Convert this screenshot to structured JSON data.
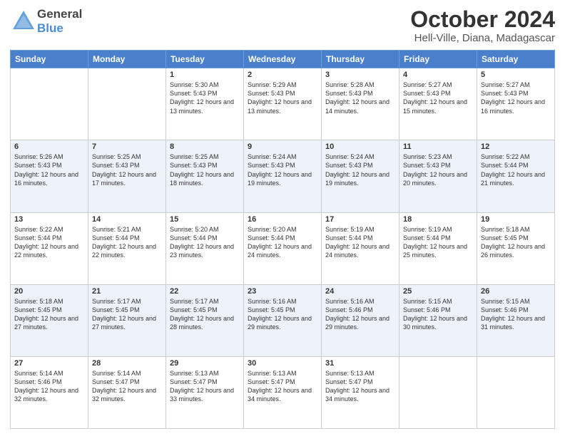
{
  "header": {
    "logo_general": "General",
    "logo_blue": "Blue",
    "month_title": "October 2024",
    "location": "Hell-Ville, Diana, Madagascar"
  },
  "weekdays": [
    "Sunday",
    "Monday",
    "Tuesday",
    "Wednesday",
    "Thursday",
    "Friday",
    "Saturday"
  ],
  "weeks": [
    [
      {
        "day": "",
        "sunrise": "",
        "sunset": "",
        "daylight": ""
      },
      {
        "day": "",
        "sunrise": "",
        "sunset": "",
        "daylight": ""
      },
      {
        "day": "1",
        "sunrise": "Sunrise: 5:30 AM",
        "sunset": "Sunset: 5:43 PM",
        "daylight": "Daylight: 12 hours and 13 minutes."
      },
      {
        "day": "2",
        "sunrise": "Sunrise: 5:29 AM",
        "sunset": "Sunset: 5:43 PM",
        "daylight": "Daylight: 12 hours and 13 minutes."
      },
      {
        "day": "3",
        "sunrise": "Sunrise: 5:28 AM",
        "sunset": "Sunset: 5:43 PM",
        "daylight": "Daylight: 12 hours and 14 minutes."
      },
      {
        "day": "4",
        "sunrise": "Sunrise: 5:27 AM",
        "sunset": "Sunset: 5:43 PM",
        "daylight": "Daylight: 12 hours and 15 minutes."
      },
      {
        "day": "5",
        "sunrise": "Sunrise: 5:27 AM",
        "sunset": "Sunset: 5:43 PM",
        "daylight": "Daylight: 12 hours and 16 minutes."
      }
    ],
    [
      {
        "day": "6",
        "sunrise": "Sunrise: 5:26 AM",
        "sunset": "Sunset: 5:43 PM",
        "daylight": "Daylight: 12 hours and 16 minutes."
      },
      {
        "day": "7",
        "sunrise": "Sunrise: 5:25 AM",
        "sunset": "Sunset: 5:43 PM",
        "daylight": "Daylight: 12 hours and 17 minutes."
      },
      {
        "day": "8",
        "sunrise": "Sunrise: 5:25 AM",
        "sunset": "Sunset: 5:43 PM",
        "daylight": "Daylight: 12 hours and 18 minutes."
      },
      {
        "day": "9",
        "sunrise": "Sunrise: 5:24 AM",
        "sunset": "Sunset: 5:43 PM",
        "daylight": "Daylight: 12 hours and 19 minutes."
      },
      {
        "day": "10",
        "sunrise": "Sunrise: 5:24 AM",
        "sunset": "Sunset: 5:43 PM",
        "daylight": "Daylight: 12 hours and 19 minutes."
      },
      {
        "day": "11",
        "sunrise": "Sunrise: 5:23 AM",
        "sunset": "Sunset: 5:43 PM",
        "daylight": "Daylight: 12 hours and 20 minutes."
      },
      {
        "day": "12",
        "sunrise": "Sunrise: 5:22 AM",
        "sunset": "Sunset: 5:44 PM",
        "daylight": "Daylight: 12 hours and 21 minutes."
      }
    ],
    [
      {
        "day": "13",
        "sunrise": "Sunrise: 5:22 AM",
        "sunset": "Sunset: 5:44 PM",
        "daylight": "Daylight: 12 hours and 22 minutes."
      },
      {
        "day": "14",
        "sunrise": "Sunrise: 5:21 AM",
        "sunset": "Sunset: 5:44 PM",
        "daylight": "Daylight: 12 hours and 22 minutes."
      },
      {
        "day": "15",
        "sunrise": "Sunrise: 5:20 AM",
        "sunset": "Sunset: 5:44 PM",
        "daylight": "Daylight: 12 hours and 23 minutes."
      },
      {
        "day": "16",
        "sunrise": "Sunrise: 5:20 AM",
        "sunset": "Sunset: 5:44 PM",
        "daylight": "Daylight: 12 hours and 24 minutes."
      },
      {
        "day": "17",
        "sunrise": "Sunrise: 5:19 AM",
        "sunset": "Sunset: 5:44 PM",
        "daylight": "Daylight: 12 hours and 24 minutes."
      },
      {
        "day": "18",
        "sunrise": "Sunrise: 5:19 AM",
        "sunset": "Sunset: 5:44 PM",
        "daylight": "Daylight: 12 hours and 25 minutes."
      },
      {
        "day": "19",
        "sunrise": "Sunrise: 5:18 AM",
        "sunset": "Sunset: 5:45 PM",
        "daylight": "Daylight: 12 hours and 26 minutes."
      }
    ],
    [
      {
        "day": "20",
        "sunrise": "Sunrise: 5:18 AM",
        "sunset": "Sunset: 5:45 PM",
        "daylight": "Daylight: 12 hours and 27 minutes."
      },
      {
        "day": "21",
        "sunrise": "Sunrise: 5:17 AM",
        "sunset": "Sunset: 5:45 PM",
        "daylight": "Daylight: 12 hours and 27 minutes."
      },
      {
        "day": "22",
        "sunrise": "Sunrise: 5:17 AM",
        "sunset": "Sunset: 5:45 PM",
        "daylight": "Daylight: 12 hours and 28 minutes."
      },
      {
        "day": "23",
        "sunrise": "Sunrise: 5:16 AM",
        "sunset": "Sunset: 5:45 PM",
        "daylight": "Daylight: 12 hours and 29 minutes."
      },
      {
        "day": "24",
        "sunrise": "Sunrise: 5:16 AM",
        "sunset": "Sunset: 5:46 PM",
        "daylight": "Daylight: 12 hours and 29 minutes."
      },
      {
        "day": "25",
        "sunrise": "Sunrise: 5:15 AM",
        "sunset": "Sunset: 5:46 PM",
        "daylight": "Daylight: 12 hours and 30 minutes."
      },
      {
        "day": "26",
        "sunrise": "Sunrise: 5:15 AM",
        "sunset": "Sunset: 5:46 PM",
        "daylight": "Daylight: 12 hours and 31 minutes."
      }
    ],
    [
      {
        "day": "27",
        "sunrise": "Sunrise: 5:14 AM",
        "sunset": "Sunset: 5:46 PM",
        "daylight": "Daylight: 12 hours and 32 minutes."
      },
      {
        "day": "28",
        "sunrise": "Sunrise: 5:14 AM",
        "sunset": "Sunset: 5:47 PM",
        "daylight": "Daylight: 12 hours and 32 minutes."
      },
      {
        "day": "29",
        "sunrise": "Sunrise: 5:13 AM",
        "sunset": "Sunset: 5:47 PM",
        "daylight": "Daylight: 12 hours and 33 minutes."
      },
      {
        "day": "30",
        "sunrise": "Sunrise: 5:13 AM",
        "sunset": "Sunset: 5:47 PM",
        "daylight": "Daylight: 12 hours and 34 minutes."
      },
      {
        "day": "31",
        "sunrise": "Sunrise: 5:13 AM",
        "sunset": "Sunset: 5:47 PM",
        "daylight": "Daylight: 12 hours and 34 minutes."
      },
      {
        "day": "",
        "sunrise": "",
        "sunset": "",
        "daylight": ""
      },
      {
        "day": "",
        "sunrise": "",
        "sunset": "",
        "daylight": ""
      }
    ]
  ]
}
